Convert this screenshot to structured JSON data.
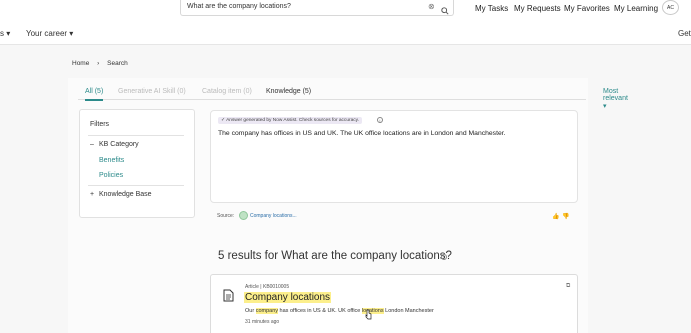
{
  "header": {
    "search": {
      "value": "What are the company locations?"
    },
    "links": [
      "My Tasks",
      "My Requests",
      "My Favorites",
      "My Learning"
    ],
    "avatar_initials": "AC"
  },
  "nav": {
    "left_cut": "s",
    "your_career": "Your career",
    "right_cut": "Get"
  },
  "breadcrumb": [
    "Home",
    "Search"
  ],
  "tabs": {
    "all": "All (5)",
    "gen_ai": "Generative AI Skill (0)",
    "catalog": "Catalog item (0)",
    "knowledge": "Knowledge (5)",
    "sort": "Most relevant"
  },
  "filters": {
    "title": "Filters",
    "kb_category": "KB Category",
    "benefits": "Benefits",
    "policies": "Policies",
    "knowledge_base": "Knowledge Base"
  },
  "answer": {
    "badge": "Answer generated by Now Assist. Check sources for accuracy.",
    "text": "The company has offices in US and UK. The UK office locations are in London and Manchester.",
    "source_label": "Source:",
    "source_link": "Company locations..."
  },
  "results": {
    "title": "5 results for What are the company locations?",
    "card": {
      "type": "Article",
      "id": "KB0010005",
      "title": "Company locations",
      "snippet_1": "Our ",
      "snippet_hl1": "company",
      "snippet_2": " has offices in US & UK. UK office ",
      "snippet_hl2": "locations",
      "snippet_3": " London Manchester",
      "time": "31 minutes ago"
    }
  },
  "colors": {
    "accent": "#2b8a8a",
    "highlight": "#fcef8c"
  }
}
